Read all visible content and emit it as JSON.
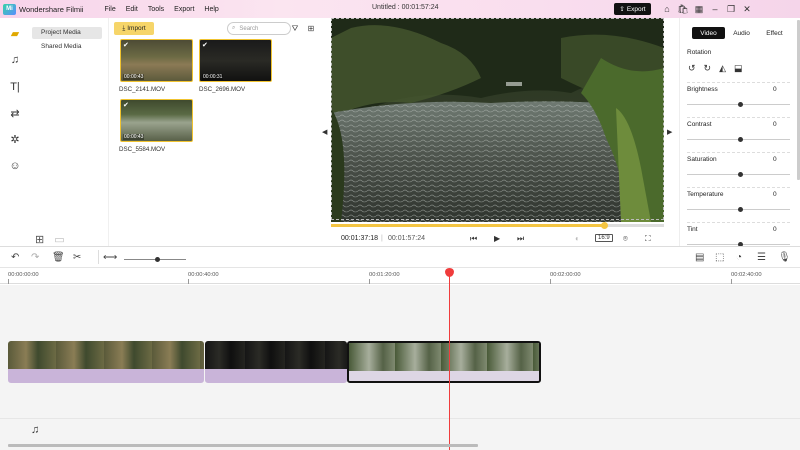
{
  "app": {
    "logo_text": "Mi",
    "name": "Wondershare Filmii",
    "menu": [
      "File",
      "Edit",
      "Tools",
      "Export",
      "Help"
    ],
    "document_title": "Untitled :   00:01:57:24",
    "export_label": "Export"
  },
  "rail_icons": [
    "folder-icon",
    "music-icon",
    "text-icon",
    "transition-icon",
    "effects-icon",
    "sticker-icon"
  ],
  "subnav": {
    "items": [
      "Project Media",
      "Shared Media"
    ]
  },
  "media": {
    "import_label": "Import",
    "search_placeholder": "Search",
    "items": [
      {
        "name": "DSC_2141.MOV",
        "duration": "00:00:43"
      },
      {
        "name": "DSC_2696.MOV",
        "duration": "00:00:31"
      },
      {
        "name": "DSC_5584.MOV",
        "duration": "00:00:43"
      }
    ]
  },
  "player": {
    "current_time": "00:01:37:18",
    "separator": "|",
    "total_time": "00:01:57:24",
    "aspect_ratio": "16:9",
    "progress": 0.82
  },
  "properties": {
    "tabs": [
      "Video",
      "Audio",
      "Effect"
    ],
    "active_tab": "Video",
    "rotation_label": "Rotation",
    "adjustments": [
      {
        "label": "Brightness",
        "value": "0"
      },
      {
        "label": "Contrast",
        "value": "0"
      },
      {
        "label": "Saturation",
        "value": "0"
      },
      {
        "label": "Temperature",
        "value": "0"
      },
      {
        "label": "Tint",
        "value": "0"
      }
    ]
  },
  "timeline": {
    "ruler": [
      "00:00:00:00",
      "00:00:40:00",
      "00:01:20:00",
      "00:02:00:00",
      "00:02:40:00"
    ],
    "playhead_time": "00:01:37:18",
    "zoom_level": 0.5
  },
  "colors": {
    "accent": "#f4c542",
    "playhead": "#f03c3c",
    "audio_track": "#c9b4d9",
    "export_bg": "#111111"
  }
}
